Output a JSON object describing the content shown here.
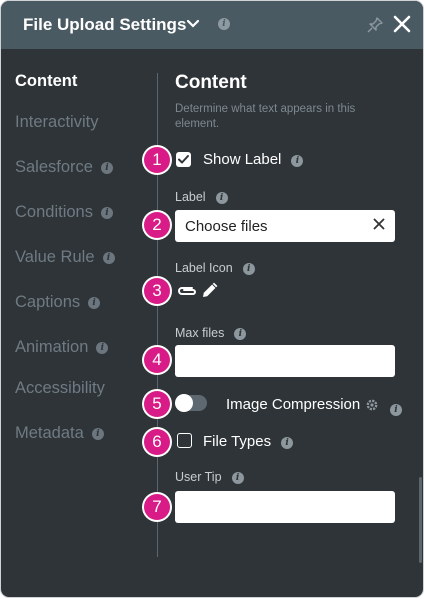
{
  "header": {
    "title": "File Upload Settings",
    "icons": [
      "chevron-down-icon",
      "info-icon",
      "pin-icon",
      "close-icon"
    ]
  },
  "sidebar": {
    "items": [
      {
        "label": "Content",
        "active": true,
        "info": false
      },
      {
        "label": "Interactivity",
        "active": false,
        "info": false
      },
      {
        "label": "Salesforce",
        "active": false,
        "info": true
      },
      {
        "label": "Conditions",
        "active": false,
        "info": true
      },
      {
        "label": "Value Rule",
        "active": false,
        "info": true
      },
      {
        "label": "Captions",
        "active": false,
        "info": true
      },
      {
        "label": "Animation",
        "active": false,
        "info": true
      },
      {
        "label": "Accessibility",
        "active": false,
        "info": false
      },
      {
        "label": "Metadata",
        "active": false,
        "info": true
      }
    ]
  },
  "content": {
    "title": "Content",
    "description": "Determine what text appears in this element.",
    "show_label": {
      "label": "Show Label",
      "checked": true
    },
    "label_field": {
      "label": "Label",
      "value": "Choose files"
    },
    "label_icon": {
      "label": "Label Icon",
      "icons": [
        "paperclip-icon",
        "pencil-icon"
      ]
    },
    "max_files": {
      "label": "Max files",
      "value": ""
    },
    "image_compression": {
      "label": "Image Compression",
      "enabled": false
    },
    "file_types": {
      "label": "File Types",
      "checked": false
    },
    "user_tip": {
      "label": "User Tip",
      "value": ""
    }
  },
  "badges": [
    "1",
    "2",
    "3",
    "4",
    "5",
    "6",
    "7"
  ],
  "colors": {
    "header_bg": "#4a5a63",
    "panel_bg": "#2f3438",
    "badge": "#d81b87",
    "muted_text": "#6f7b83"
  },
  "info_glyph": "i",
  "close_glyph": "✕"
}
